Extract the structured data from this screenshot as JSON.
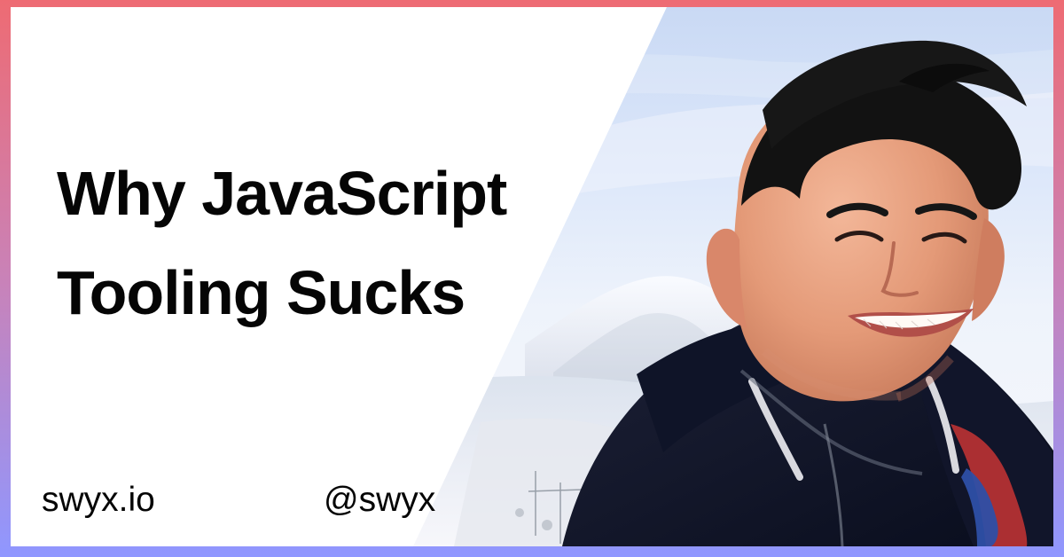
{
  "headline": {
    "line1": "Why JavaScript",
    "line2": "Tooling Sucks"
  },
  "footer": {
    "site": "swyx.io",
    "handle": "@swyx"
  }
}
